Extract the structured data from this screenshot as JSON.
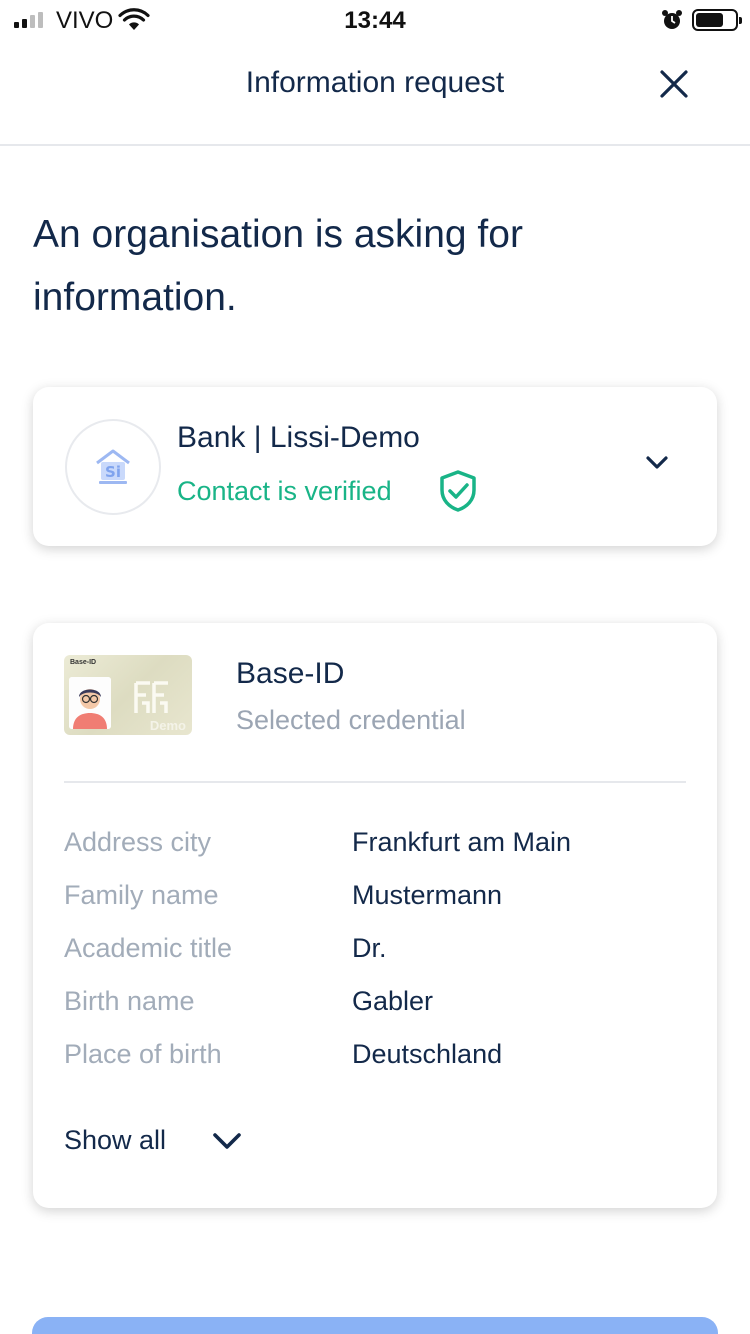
{
  "status_bar": {
    "carrier": "VIVO",
    "time": "13:44",
    "battery_level": 0.7
  },
  "header": {
    "title": "Information request",
    "close_icon": "close-icon"
  },
  "heading": "An organisation is asking for information.",
  "organisation": {
    "name": "Bank | Lissi-Demo",
    "status": "Contact is verified",
    "status_color": "#19b487",
    "icons": {
      "logo": "bank-logo-icon",
      "verified": "shield-check-icon",
      "expand": "chevron-down-icon"
    }
  },
  "credential": {
    "thumbnail": {
      "tag": "Base-ID",
      "watermark": "Demo"
    },
    "title": "Base-ID",
    "subtitle": "Selected credential",
    "attributes": [
      {
        "label": "Address city",
        "value": "Frankfurt am Main"
      },
      {
        "label": "Family name",
        "value": "Mustermann"
      },
      {
        "label": "Academic title",
        "value": "Dr."
      },
      {
        "label": "Birth name",
        "value": "Gabler"
      },
      {
        "label": "Place of birth",
        "value": "Deutschland"
      }
    ],
    "show_all_label": "Show all"
  },
  "colors": {
    "primary_text": "#13294a",
    "muted_text": "#a2acb9",
    "accent_green": "#19b487",
    "button_blue": "#8ab2f5"
  }
}
